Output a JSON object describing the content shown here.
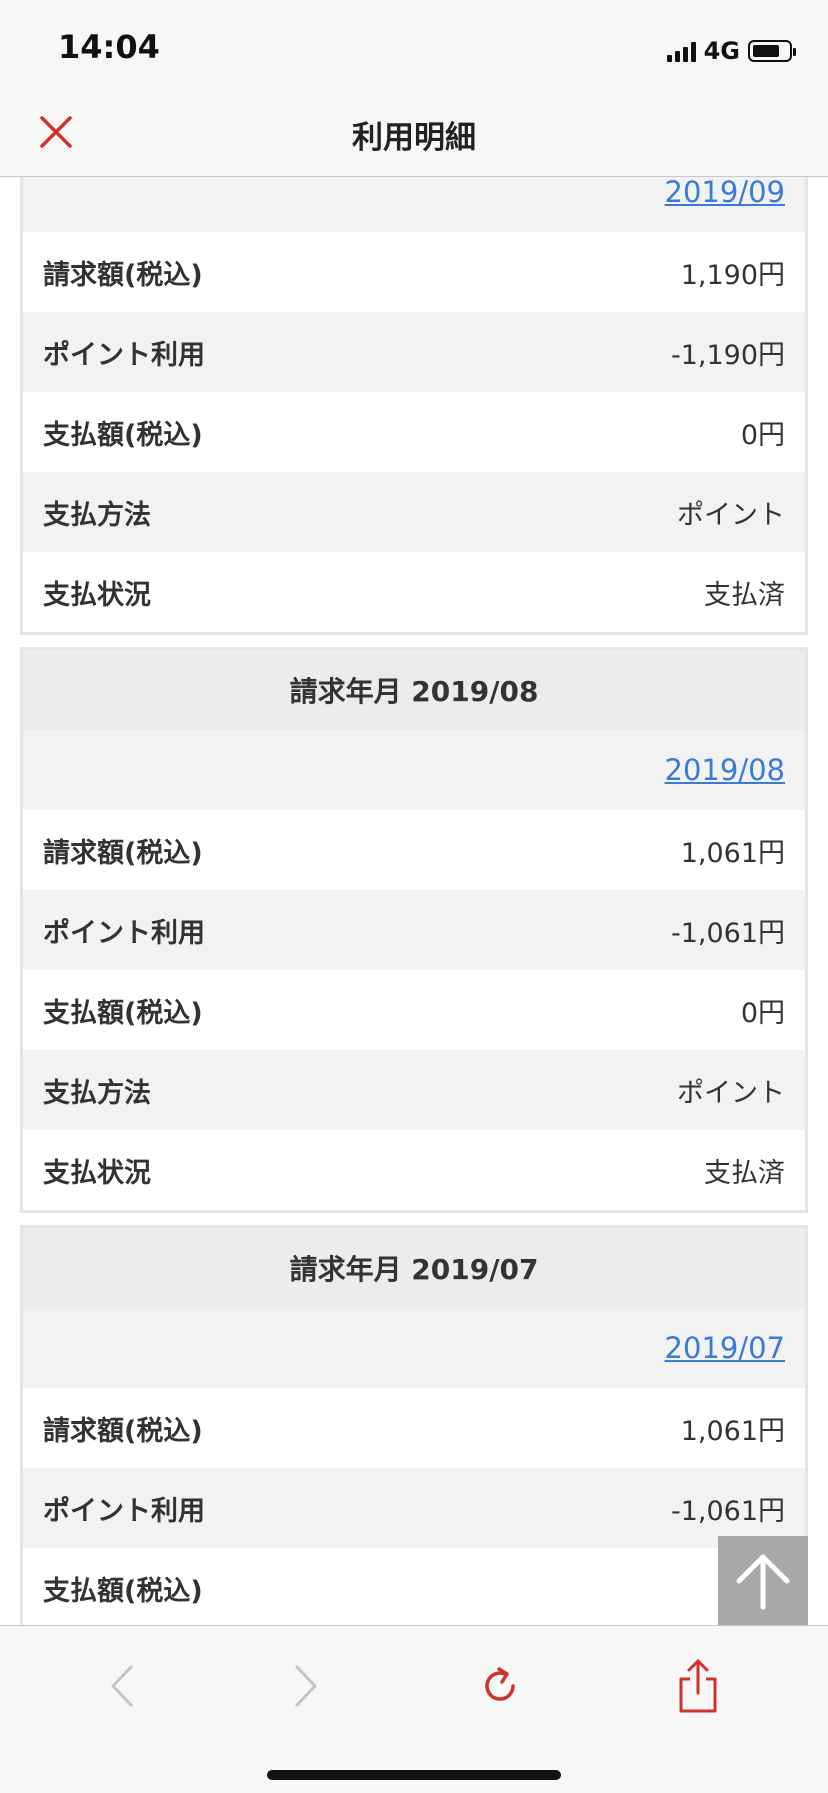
{
  "status_bar": {
    "time": "14:04",
    "network": "4G"
  },
  "nav": {
    "title": "利用明細",
    "close_icon": "close-icon"
  },
  "labels": {
    "billed": "請求額(税込)",
    "points": "ポイント利用",
    "paid": "支払額(税込)",
    "method": "支払方法",
    "status": "支払状況"
  },
  "statements": [
    {
      "header": "",
      "link": "2019/09",
      "billed": "1,190円",
      "points": "-1,190円",
      "paid": "0円",
      "method": "ポイント",
      "status": "支払済"
    },
    {
      "header": "請求年月 2019/08",
      "link": "2019/08",
      "billed": "1,061円",
      "points": "-1,061円",
      "paid": "0円",
      "method": "ポイント",
      "status": "支払済"
    },
    {
      "header": "請求年月 2019/07",
      "link": "2019/07",
      "billed": "1,061円",
      "points": "-1,061円",
      "paid": "",
      "method": "",
      "status": ""
    }
  ],
  "toolbar": {
    "back_icon": "chevron-left-icon",
    "forward_icon": "chevron-right-icon",
    "reload_icon": "reload-icon",
    "share_icon": "share-icon"
  },
  "colors": {
    "accent_red": "#d0312d",
    "link_blue": "#3a7bd5"
  }
}
